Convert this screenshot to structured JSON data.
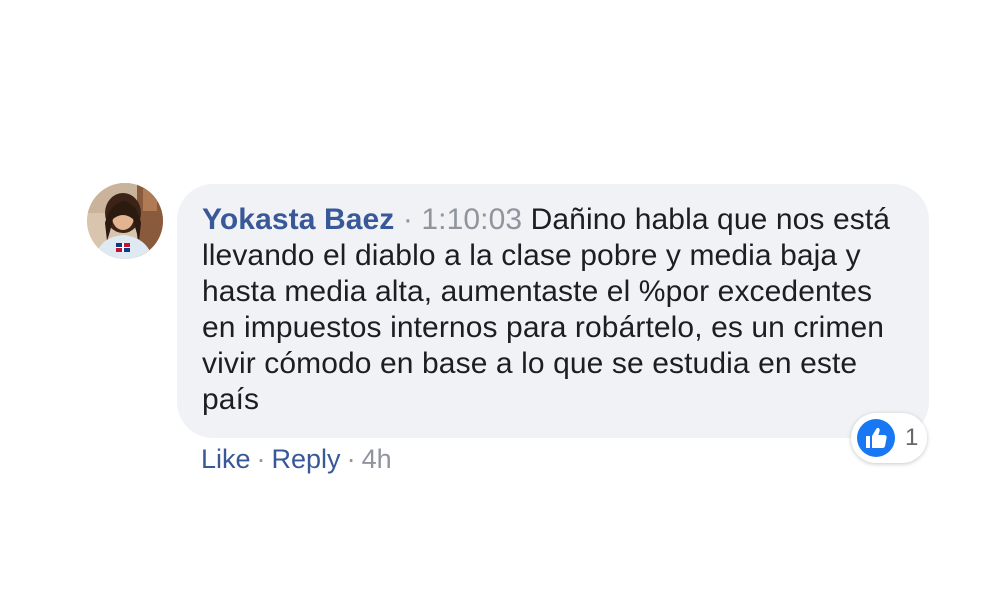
{
  "comment": {
    "author": "Yokasta Baez",
    "separator": "·",
    "timestamp": "1:10:03",
    "body": "Dañino habla que nos está llevando el diablo a la clase pobre y media baja y hasta media alta, aumentaste el %por excedentes en impuestos internos para robártelo, es un crimen vivir cómodo en base a lo que se estudia en este país"
  },
  "reactions": {
    "icon": "like-thumbs-up-icon",
    "count": "1",
    "color": "#1877f2"
  },
  "actions": {
    "like_label": "Like",
    "dot": "·",
    "reply_label": "Reply",
    "time": "4h"
  },
  "colors": {
    "author": "#385898",
    "bubble_bg": "#f0f2f5",
    "text": "#1c1e21",
    "muted": "#90949c"
  }
}
